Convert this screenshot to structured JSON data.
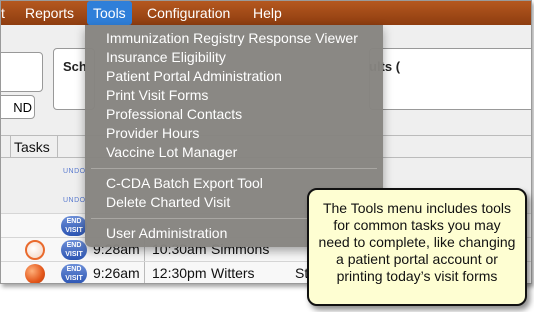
{
  "menubar": {
    "items": [
      {
        "label": "t"
      },
      {
        "label": "Reports"
      },
      {
        "label": "Tools"
      },
      {
        "label": "Configuration"
      },
      {
        "label": "Help"
      }
    ]
  },
  "app": {
    "left_button_label": "ND",
    "panel_left_label": "Sch",
    "panel_right_label": "ults (",
    "col_tasks": "Tasks",
    "undo_label": "UNDO",
    "rows": [
      {
        "end_visit": "END VISIT",
        "time": "",
        "appt": "",
        "name": "",
        "extra": ""
      },
      {
        "end_visit": "END VISIT",
        "time": "9:28am",
        "appt": "10:30am",
        "name": "Simmons",
        "extra": ""
      },
      {
        "end_visit": "END VISIT",
        "time": "9:26am",
        "appt": "12:30pm",
        "name": "Witters",
        "extra": "St"
      }
    ]
  },
  "tools_menu": {
    "items": [
      {
        "label": "Immunization Registry Response Viewer"
      },
      {
        "label": "Insurance Eligibility"
      },
      {
        "label": "Patient Portal Administration"
      },
      {
        "label": "Print Visit Forms"
      },
      {
        "label": "Professional Contacts"
      },
      {
        "label": "Provider Hours"
      },
      {
        "label": "Vaccine Lot Manager"
      },
      {
        "label": "C-CDA Batch Export Tool"
      },
      {
        "label": "Delete Charted Visit"
      },
      {
        "label": "User Administration"
      }
    ]
  },
  "callout": {
    "text": "The Tools menu includes tools for common tasks you may need to complete, like changing a patient portal account or printing today’s visit forms"
  },
  "colors": {
    "menubar": "#a04a18",
    "menu_active": "#2f7fd9",
    "dropdown_bg": "#868480",
    "callout_bg": "#fefed2",
    "status_orange": "#e3561a",
    "end_visit_blue": "#3a63c0"
  }
}
